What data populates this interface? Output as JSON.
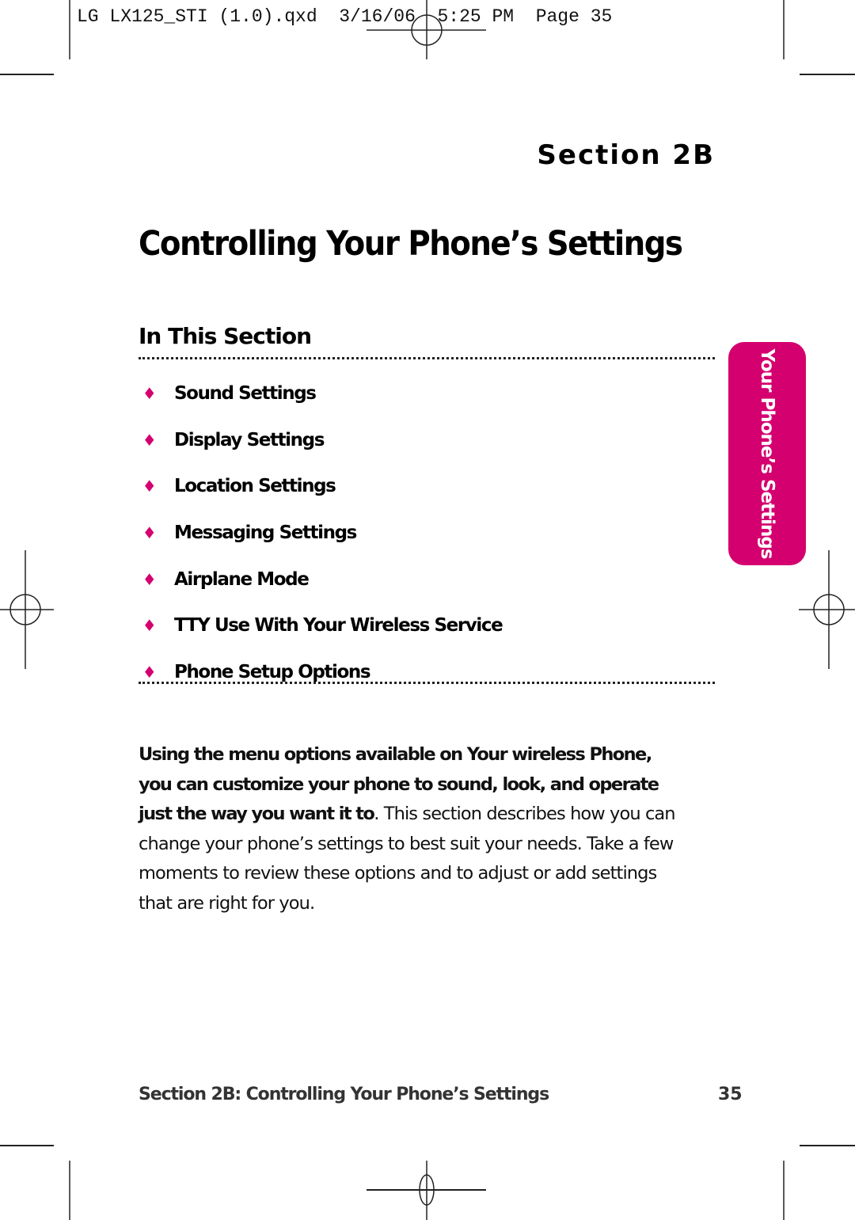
{
  "slug": {
    "text": "LG LX125_STI (1.0).qxd  3/16/06  5:25 PM  Page 35"
  },
  "header": {
    "section_label": "Section 2B",
    "page_title": "Controlling Your Phone’s Settings"
  },
  "in_this_section": {
    "heading": "In This Section",
    "bullet_icon": "diamond-bullet",
    "items": [
      {
        "label": "Sound Settings"
      },
      {
        "label": "Display Settings"
      },
      {
        "label": "Location Settings"
      },
      {
        "label": "Messaging Settings"
      },
      {
        "label": "Airplane Mode"
      },
      {
        "label": "TTY Use With Your Wireless Service"
      },
      {
        "label": "Phone Setup Options"
      }
    ]
  },
  "side_tab": {
    "label": "Your Phone’s Settings",
    "color": "#d4006f"
  },
  "intro": {
    "lead": "Using the menu options available on Your wireless Phone, you can customize your phone to sound, look, and operate just the way you want it to",
    "body": ". This section describes how you can change your phone’s settings to best suit your needs. Take a few moments to review these options and to adjust or add settings that are right for you."
  },
  "footer": {
    "title": "Section 2B: Controlling Your Phone’s Settings",
    "page_number": "35"
  },
  "colors": {
    "accent": "#d4006f",
    "text": "#000000",
    "footer_text": "#333333"
  }
}
